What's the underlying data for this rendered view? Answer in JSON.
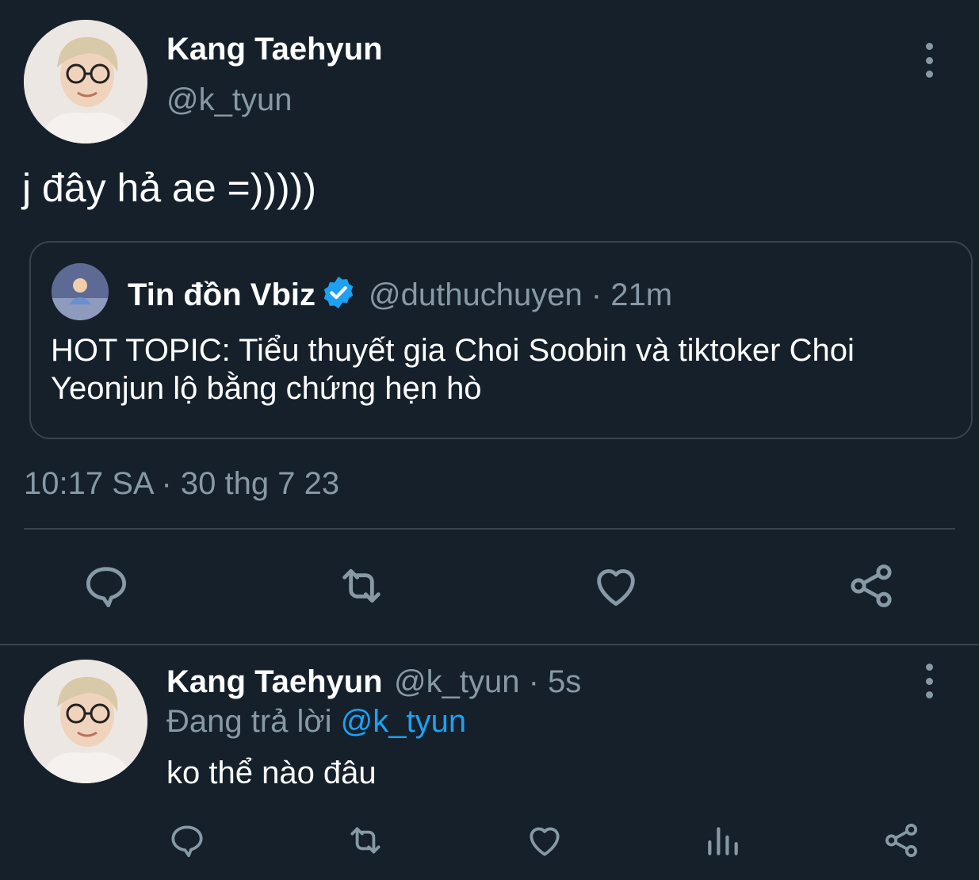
{
  "main_tweet": {
    "author_name": "Kang Taehyun",
    "author_handle": "@k_tyun",
    "text": "j đây hả ae =)))))",
    "timestamp": "10:17 SA · 30 thg 7 23",
    "quoted": {
      "author_name": "Tin đồn Vbiz",
      "author_handle": "@duthuchuyen · 21m",
      "verified": true,
      "body": "HOT TOPIC: Tiểu thuyết gia Choi Soobin và tiktoker Choi Yeonjun lộ bằng chứng hẹn hò"
    },
    "actions": [
      "reply-icon",
      "retweet-icon",
      "like-icon",
      "share-icon"
    ]
  },
  "reply_tweet": {
    "author_name": "Kang Taehyun",
    "author_handle": "@k_tyun · 5s",
    "replying_to_prefix": "Đang trả lời",
    "replying_to_mention": "@k_tyun",
    "text": "ko thể nào đâu",
    "actions": [
      "reply-icon",
      "retweet-icon",
      "like-icon",
      "analytics-icon",
      "share-icon"
    ]
  },
  "colors": {
    "background": "#15202b",
    "text_primary": "#ffffff",
    "text_secondary": "#8899a6",
    "accent": "#1da1f2",
    "border": "#38444d"
  }
}
